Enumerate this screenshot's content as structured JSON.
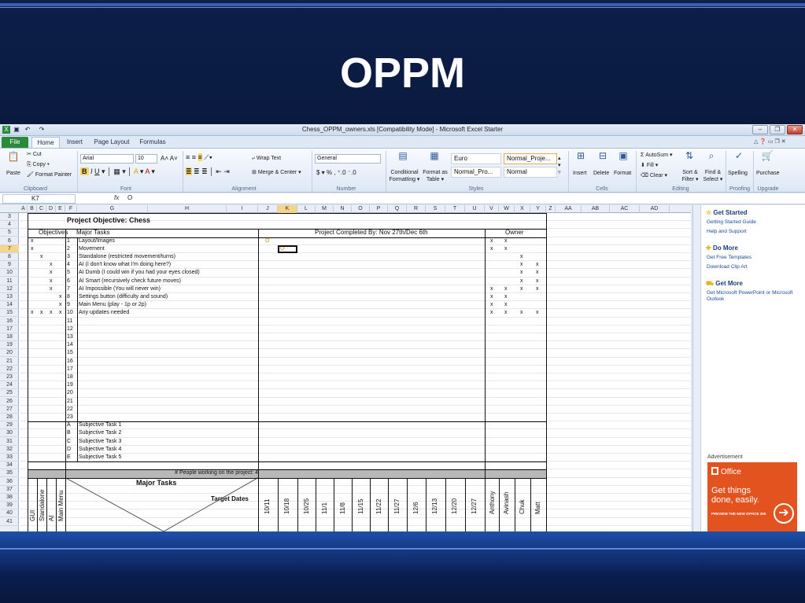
{
  "slide": {
    "title": "OPPM"
  },
  "window": {
    "title": "Chess_OPPM_owners.xls  [Compatibility Mode]  -  Microsoft Excel Starter",
    "quick_access": [
      "save-icon",
      "undo-icon",
      "redo-icon"
    ],
    "controls": [
      "minimize",
      "restore",
      "close"
    ]
  },
  "tabs": [
    {
      "label": "File"
    },
    {
      "label": "Home"
    },
    {
      "label": "Insert"
    },
    {
      "label": "Page Layout"
    },
    {
      "label": "Formulas"
    }
  ],
  "ribbon": {
    "clipboard": {
      "paste": "Paste",
      "cut": "Cut",
      "copy": "Copy ▾",
      "format_painter": "Format Painter",
      "group": "Clipboard"
    },
    "font": {
      "name": "Arial",
      "size": "10",
      "group": "Font"
    },
    "alignment": {
      "wrap": "Wrap Text",
      "merge": "Merge & Center ▾",
      "group": "Alignment"
    },
    "number": {
      "format": "General",
      "group": "Number"
    },
    "styles": {
      "conditional": "Conditional Formatting ▾",
      "format_table": "Format as Table ▾",
      "cell_styles": [
        "Euro",
        "Normal_Proje...",
        "Normal_Pro...",
        "Normal"
      ],
      "group": "Styles"
    },
    "cells": {
      "insert": "Insert",
      "delete": "Delete",
      "format": "Format",
      "group": "Cells"
    },
    "editing": {
      "autosum": "AutoSum ▾",
      "fill": "Fill ▾",
      "clear": "Clear ▾",
      "sort": "Sort & Filter ▾",
      "find": "Find & Select ▾",
      "group": "Editing"
    },
    "proofing": {
      "spelling": "Spelling",
      "group": "Proofing"
    },
    "upgrade": {
      "purchase": "Purchase",
      "group": "Upgrade"
    }
  },
  "formula_bar": {
    "name_box": "K7",
    "fx": "fx",
    "value": "O"
  },
  "sheet": {
    "columns": [
      "A",
      "B",
      "C",
      "D",
      "E",
      "F",
      "G",
      "H",
      "I",
      "J",
      "K",
      "L",
      "M",
      "N",
      "O",
      "P",
      "Q",
      "R",
      "S",
      "T",
      "U",
      "V",
      "W",
      "X",
      "Y",
      "Z",
      "AA",
      "AB",
      "AC",
      "AD"
    ],
    "selected_column": "K",
    "rows": [
      "3",
      "4",
      "5",
      "6",
      "7",
      "8",
      "9",
      "10",
      "11",
      "12",
      "13",
      "14",
      "15",
      "16",
      "17",
      "18",
      "19",
      "20",
      "21",
      "22",
      "23",
      "24",
      "25",
      "26",
      "27",
      "28",
      "29",
      "30",
      "31",
      "32",
      "33",
      "34",
      "35",
      "36",
      "37",
      "38",
      "39",
      "40",
      "41"
    ],
    "selected_row": "7",
    "project_objective": "Project Objective: Chess",
    "objectives_header": "Objectives",
    "major_tasks_header": "Major Tasks",
    "completed_header": "Project Completed By: Nov 27th/Dec 6th",
    "owner_header": "Owner",
    "tasks": [
      {
        "num": "1",
        "name": "Layout/Images"
      },
      {
        "num": "2",
        "name": "Movement"
      },
      {
        "num": "3",
        "name": "Standalone (restricted movement/turns)"
      },
      {
        "num": "4",
        "name": "AI (I don't know what I'm doing here?)"
      },
      {
        "num": "5",
        "name": "AI Dumb (I could win if you had your eyes closed)"
      },
      {
        "num": "6",
        "name": "AI Smart (recursively check future moves)"
      },
      {
        "num": "7",
        "name": "AI Impossible (You will never win)"
      },
      {
        "num": "8",
        "name": "Settings button (difficulty and sound)"
      },
      {
        "num": "9",
        "name": "Main Menu (play - 1p or 2p)"
      },
      {
        "num": "10",
        "name": "Any updates needed"
      },
      {
        "num": "11",
        "name": ""
      },
      {
        "num": "12",
        "name": ""
      },
      {
        "num": "13",
        "name": ""
      },
      {
        "num": "14",
        "name": ""
      },
      {
        "num": "15",
        "name": ""
      },
      {
        "num": "16",
        "name": ""
      },
      {
        "num": "17",
        "name": ""
      },
      {
        "num": "18",
        "name": ""
      },
      {
        "num": "19",
        "name": ""
      },
      {
        "num": "20",
        "name": ""
      },
      {
        "num": "21",
        "name": ""
      },
      {
        "num": "22",
        "name": ""
      },
      {
        "num": "23",
        "name": ""
      }
    ],
    "subjective_tasks": [
      {
        "num": "A",
        "name": "Subjective Task 1"
      },
      {
        "num": "B",
        "name": "Subjective Task 2"
      },
      {
        "num": "C",
        "name": "Subjective Task 3"
      },
      {
        "num": "D",
        "name": "Subjective Task 4"
      },
      {
        "num": "E",
        "name": "Subjective Task 5"
      }
    ],
    "progress_marker": "O",
    "people_working": "# People working on the project: 4",
    "bottom_major_tasks": "Major Tasks",
    "target_dates_label": "Target Dates",
    "objective_labels": [
      "GUI",
      "Standalone",
      "AI",
      "Main Menu"
    ],
    "target_dates": [
      "10/11",
      "10/18",
      "10/25",
      "11/1",
      "11/8",
      "11/15",
      "11/22",
      "11/27",
      "12/6",
      "12/13",
      "12/20",
      "12/27"
    ],
    "owners": [
      "Anthony",
      "Avinash",
      "Chuk",
      "Matt"
    ]
  },
  "task_pane": {
    "get_started": "Get Started",
    "get_started_links": [
      "Getting Started Guide",
      "Help and Support"
    ],
    "do_more": "Do More",
    "do_more_links": [
      "Get Free Templates",
      "Download Clip Art"
    ],
    "get_more": "Get More",
    "get_more_links": [
      "Get Microsoft PowerPoint or Microsoft Outlook"
    ],
    "ad_label": "Advertisement",
    "ad": {
      "brand": "Office",
      "headline": "Get things done, easily.",
      "cta": "PREVIEW THE NEW OFFICE 365"
    }
  }
}
